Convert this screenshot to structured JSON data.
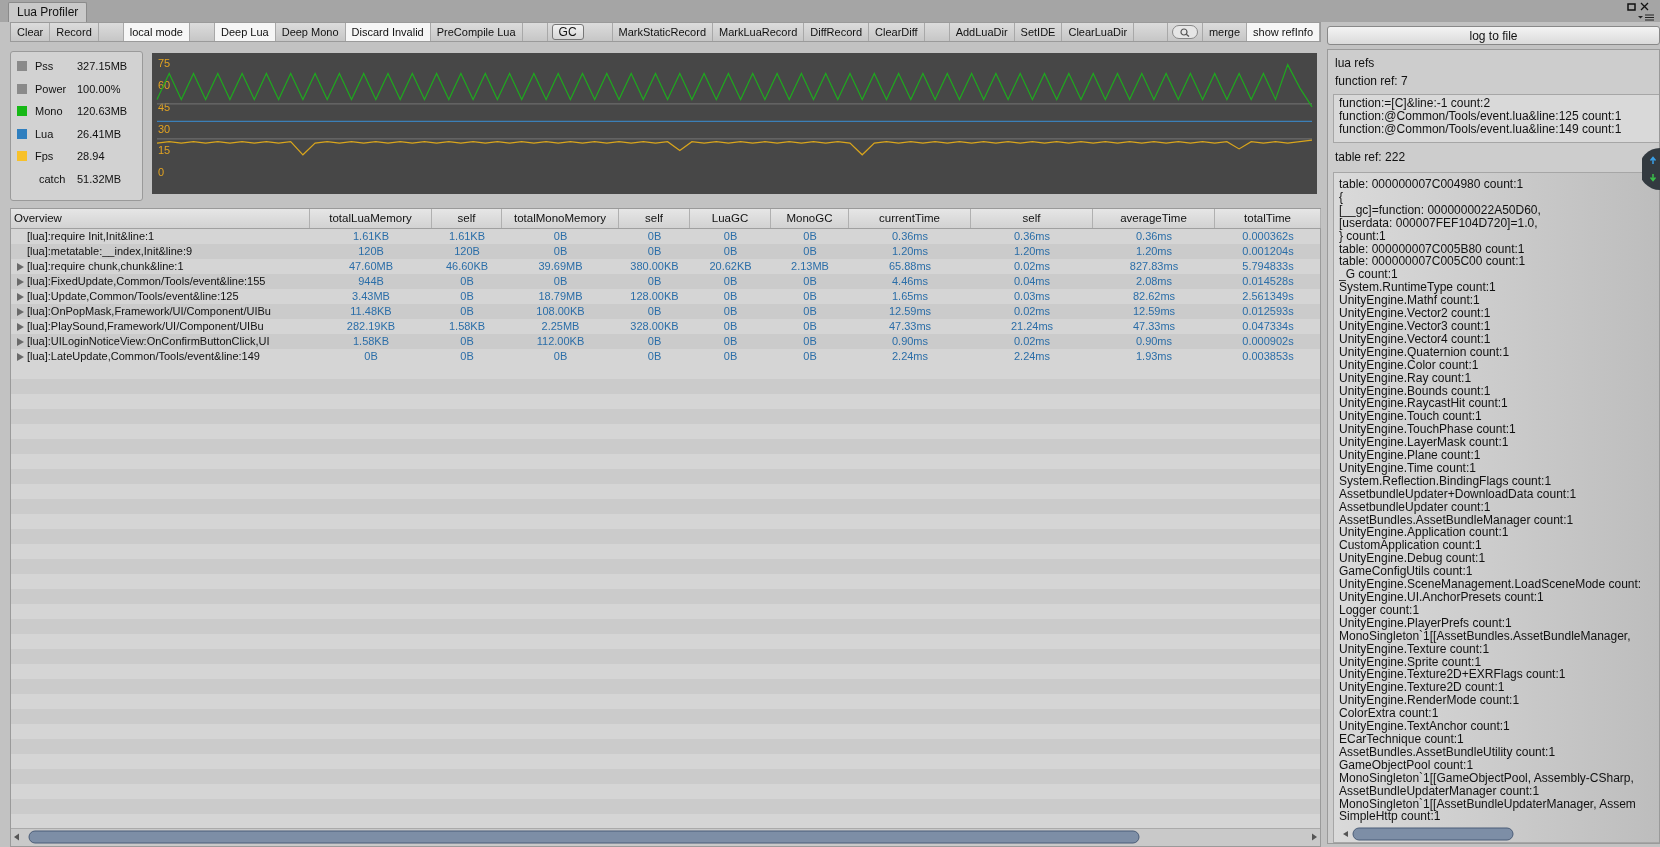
{
  "window": {
    "title": "Lua Profiler"
  },
  "toolbar": {
    "groups": [
      [
        {
          "label": "Clear",
          "kind": "button"
        },
        {
          "label": "Record",
          "kind": "button"
        }
      ],
      [
        {
          "label": "local mode",
          "kind": "toggle",
          "on": true
        }
      ],
      [
        {
          "label": "Deep Lua",
          "kind": "toggle",
          "on": true
        },
        {
          "label": "Deep Mono",
          "kind": "toggle",
          "on": false
        },
        {
          "label": "Discard Invalid",
          "kind": "toggle",
          "on": true
        },
        {
          "label": "PreCompile Lua",
          "kind": "toggle",
          "on": false
        }
      ],
      [
        {
          "label": "GC",
          "kind": "round"
        }
      ],
      [
        {
          "label": "MarkStaticRecord",
          "kind": "button"
        },
        {
          "label": "MarkLuaRecord",
          "kind": "button"
        },
        {
          "label": "DiffRecord",
          "kind": "button"
        },
        {
          "label": "ClearDiff",
          "kind": "button"
        }
      ],
      [
        {
          "label": "AddLuaDir",
          "kind": "button"
        },
        {
          "label": "SetIDE",
          "kind": "button"
        },
        {
          "label": "ClearLuaDir",
          "kind": "button"
        }
      ]
    ],
    "right": [
      {
        "label": "merge",
        "kind": "toggle",
        "on": false
      },
      {
        "label": "show refInfo",
        "kind": "toggle",
        "on": true
      }
    ]
  },
  "log_button": "log to file",
  "legend": [
    {
      "name": "Pss",
      "value": "327.15MB",
      "color": "#8a8a8a"
    },
    {
      "name": "Power",
      "value": "100.00%",
      "color": "#8a8a8a"
    },
    {
      "name": "Mono",
      "value": "120.63MB",
      "color": "#16b816"
    },
    {
      "name": "Lua",
      "value": "26.41MB",
      "color": "#2f7fbf"
    },
    {
      "name": "Fps",
      "value": "28.94",
      "color": "#f7c12a"
    },
    {
      "name": "catch",
      "value": "51.32MB"
    }
  ],
  "chart_data": {
    "type": "line",
    "ylim": [
      -15,
      82
    ],
    "yticks": [
      0,
      15,
      30,
      45,
      60,
      75
    ],
    "series": [
      {
        "color": "#6b6b6b",
        "values": [
          47,
          47,
          47,
          47,
          47,
          47,
          47,
          47,
          47,
          47,
          47,
          47,
          47,
          47,
          47,
          47,
          47,
          47,
          47,
          47,
          47,
          47,
          47,
          47,
          47,
          47,
          47,
          47,
          47,
          47,
          47,
          47,
          47,
          47,
          47,
          47,
          47,
          47,
          47,
          47,
          47,
          47,
          47,
          47,
          47,
          47,
          47,
          47,
          47,
          47,
          47,
          47,
          47,
          47,
          47,
          47,
          47,
          47,
          47,
          47,
          47,
          47,
          47,
          47,
          47,
          47,
          47,
          47,
          47,
          47,
          47,
          47,
          47,
          47,
          47,
          47,
          47,
          47,
          47,
          47,
          47,
          47,
          47,
          47,
          47,
          47,
          47,
          47,
          47,
          47,
          47,
          47,
          47,
          47,
          47,
          47
        ]
      },
      {
        "color": "#6b6b6b",
        "values": [
          23,
          23,
          23,
          23,
          23,
          23,
          23,
          23,
          23,
          23,
          23,
          23,
          23,
          23,
          23,
          23,
          23,
          23,
          23,
          23,
          23,
          23,
          23,
          23,
          23,
          23,
          23,
          23,
          23,
          23,
          23,
          23,
          23,
          23,
          23,
          23,
          23,
          23,
          23,
          23,
          23,
          23,
          23,
          23,
          23,
          23,
          23,
          23,
          23,
          23,
          23,
          23,
          23,
          23,
          23,
          23,
          23,
          23,
          23,
          23,
          23,
          23,
          23,
          23,
          23,
          23,
          23,
          23,
          23,
          23,
          23,
          23,
          23,
          23,
          23,
          23,
          23,
          23,
          23,
          23,
          23,
          23,
          23,
          23,
          23,
          23,
          23,
          23,
          23,
          23,
          23,
          23,
          23,
          23,
          23,
          23
        ]
      },
      {
        "color": "#1fa81f",
        "values": [
          50,
          68,
          50,
          68,
          50,
          68,
          50,
          68,
          50,
          68,
          50,
          68,
          50,
          68,
          50,
          68,
          50,
          68,
          50,
          68,
          50,
          68,
          50,
          68,
          50,
          68,
          50,
          68,
          50,
          68,
          50,
          68,
          50,
          68,
          50,
          68,
          50,
          68,
          50,
          68,
          50,
          68,
          50,
          68,
          50,
          68,
          50,
          68,
          50,
          68,
          50,
          68,
          50,
          68,
          50,
          68,
          50,
          68,
          50,
          68,
          50,
          68,
          50,
          68,
          50,
          68,
          50,
          68,
          50,
          68,
          50,
          68,
          50,
          68,
          50,
          68,
          50,
          68,
          50,
          68,
          50,
          68,
          50,
          68,
          50,
          68,
          50,
          68,
          50,
          68,
          50,
          68,
          50,
          74,
          58,
          45
        ]
      },
      {
        "color": "#3b7fb8",
        "values": [
          35,
          35,
          35,
          35,
          35,
          35,
          35,
          35,
          35,
          35,
          35,
          35,
          35,
          35,
          35,
          35,
          35,
          35,
          35,
          35,
          35,
          35,
          35,
          35,
          35,
          35,
          35,
          35,
          35,
          35,
          35,
          35,
          35,
          35,
          35,
          35,
          35,
          35,
          35,
          35,
          35,
          35,
          35,
          35,
          35,
          35,
          35,
          35,
          35,
          35,
          35,
          35,
          35,
          35,
          35,
          35,
          35,
          35,
          35,
          35,
          35,
          35,
          35,
          35,
          35,
          35,
          35,
          35,
          35,
          35,
          35,
          35,
          35,
          35,
          35,
          35,
          35,
          35,
          35,
          35,
          35,
          35,
          35,
          35,
          35,
          35,
          35,
          35,
          35,
          35,
          35,
          35,
          35,
          35,
          35,
          35
        ]
      },
      {
        "color": "#d9a51c",
        "values": [
          20,
          21,
          20,
          21,
          20,
          21,
          20,
          21,
          20,
          21,
          20,
          21,
          12,
          20,
          21,
          20,
          21,
          20,
          21,
          20,
          21,
          20,
          21,
          20,
          21,
          20,
          21,
          20,
          21,
          20,
          21,
          20,
          21,
          20,
          21,
          20,
          21,
          20,
          21,
          20,
          21,
          20,
          21,
          15,
          21,
          20,
          21,
          20,
          21,
          20,
          21,
          20,
          21,
          20,
          21,
          20,
          21,
          20,
          12,
          20,
          21,
          20,
          21,
          20,
          21,
          20,
          21,
          20,
          21,
          20,
          21,
          20,
          21,
          20,
          21,
          20,
          21,
          20,
          21,
          20,
          21,
          20,
          21,
          20,
          21,
          20,
          21,
          20,
          21,
          16,
          21,
          20,
          21,
          20,
          21,
          22
        ]
      }
    ]
  },
  "table": {
    "columns": [
      "Overview",
      "totalLuaMemory",
      "self",
      "totalMonoMemory",
      "self",
      "LuaGC",
      "MonoGC",
      "currentTime",
      "self",
      "averageTime",
      "totalTime"
    ],
    "rows": [
      {
        "expandable": false,
        "cells": [
          "[lua]:require Init,Init&line:1",
          "1.61KB",
          "1.61KB",
          "0B",
          "0B",
          "0B",
          "0B",
          "0.36ms",
          "0.36ms",
          "0.36ms",
          "0.000362s"
        ]
      },
      {
        "expandable": false,
        "cells": [
          "[lua]:metatable:__index,Init&line:9",
          "120B",
          "120B",
          "0B",
          "0B",
          "0B",
          "0B",
          "1.20ms",
          "1.20ms",
          "1.20ms",
          "0.001204s"
        ]
      },
      {
        "expandable": true,
        "cells": [
          "[lua]:require chunk,chunk&line:1",
          "47.60MB",
          "46.60KB",
          "39.69MB",
          "380.00KB",
          "20.62KB",
          "2.13MB",
          "65.88ms",
          "0.02ms",
          "827.83ms",
          "5.794833s"
        ]
      },
      {
        "expandable": true,
        "cells": [
          "[lua]:FixedUpdate,Common/Tools/event&line:155",
          "944B",
          "0B",
          "0B",
          "0B",
          "0B",
          "0B",
          "4.46ms",
          "0.04ms",
          "2.08ms",
          "0.014528s"
        ]
      },
      {
        "expandable": true,
        "cells": [
          "[lua]:Update,Common/Tools/event&line:125",
          "3.43MB",
          "0B",
          "18.79MB",
          "128.00KB",
          "0B",
          "0B",
          "1.65ms",
          "0.03ms",
          "82.62ms",
          "2.561349s"
        ]
      },
      {
        "expandable": true,
        "cells": [
          "[lua]:OnPopMask,Framework/UI/Component/UIBu",
          "11.48KB",
          "0B",
          "108.00KB",
          "0B",
          "0B",
          "0B",
          "12.59ms",
          "0.02ms",
          "12.59ms",
          "0.012593s"
        ]
      },
      {
        "expandable": true,
        "cells": [
          "[lua]:PlaySound,Framework/UI/Component/UIBu",
          "282.19KB",
          "1.58KB",
          "2.25MB",
          "328.00KB",
          "0B",
          "0B",
          "47.33ms",
          "21.24ms",
          "47.33ms",
          "0.047334s"
        ]
      },
      {
        "expandable": true,
        "cells": [
          "[lua]:UILoginNoticeView:OnConfirmButtonClick,UI",
          "1.58KB",
          "0B",
          "112.00KB",
          "0B",
          "0B",
          "0B",
          "0.90ms",
          "0.02ms",
          "0.90ms",
          "0.000902s"
        ]
      },
      {
        "expandable": true,
        "cells": [
          "[lua]:LateUpdate,Common/Tools/event&line:149",
          "0B",
          "0B",
          "0B",
          "0B",
          "0B",
          "0B",
          "2.24ms",
          "2.24ms",
          "1.93ms",
          "0.003853s"
        ]
      }
    ]
  },
  "refs": {
    "title": "lua refs",
    "function_ref": "function ref: 7",
    "functions": [
      "function:=[C]&line:-1 count:2",
      "function:@Common/Tools/event.lua&line:125 count:1",
      "function:@Common/Tools/event.lua&line:149 count:1"
    ],
    "table_ref": "table ref: 222",
    "tables": [
      "table: 000000007C004980 count:1",
      "{",
      "[__gc]=function: 0000000022A50D60,",
      "[userdata: 000007FEF104D720]=1.0,",
      "} count:1",
      "table: 000000007C005B80 count:1",
      "table: 000000007C005C00 count:1",
      "_G count:1",
      "System.RuntimeType count:1",
      "UnityEngine.Mathf count:1",
      "UnityEngine.Vector2 count:1",
      "UnityEngine.Vector3 count:1",
      "UnityEngine.Vector4 count:1",
      "UnityEngine.Quaternion count:1",
      "UnityEngine.Color count:1",
      "UnityEngine.Ray count:1",
      "UnityEngine.Bounds count:1",
      "UnityEngine.RaycastHit count:1",
      "UnityEngine.Touch count:1",
      "UnityEngine.TouchPhase count:1",
      "UnityEngine.LayerMask count:1",
      "UnityEngine.Plane count:1",
      "UnityEngine.Time count:1",
      "System.Reflection.BindingFlags count:1",
      "AssetbundleUpdater+DownloadData count:1",
      "AssetbundleUpdater count:1",
      "AssetBundles.AssetBundleManager count:1",
      "UnityEngine.Application count:1",
      "CustomApplication count:1",
      "UnityEngine.Debug count:1",
      "GameConfigUtils count:1",
      "UnityEngine.SceneManagement.LoadSceneMode count:",
      "UnityEngine.UI.AnchorPresets count:1",
      "Logger count:1",
      "UnityEngine.PlayerPrefs count:1",
      "MonoSingleton`1[[AssetBundles.AssetBundleManager,",
      "UnityEngine.Texture count:1",
      "UnityEngine.Sprite count:1",
      "UnityEngine.Texture2D+EXRFlags count:1",
      "UnityEngine.Texture2D count:1",
      "UnityEngine.RenderMode count:1",
      "ColorExtra count:1",
      "UnityEngine.TextAnchor count:1",
      "ECarTechnique count:1",
      "AssetBundles.AssetBundleUtility count:1",
      "GameObjectPool count:1",
      "MonoSingleton`1[[GameObjectPool, Assembly-CSharp,",
      "AssetBundleUpdaterManager count:1",
      "MonoSingleton`1[[AssetBundleUpdaterManager, Assem",
      "SimpleHttp count:1"
    ]
  }
}
